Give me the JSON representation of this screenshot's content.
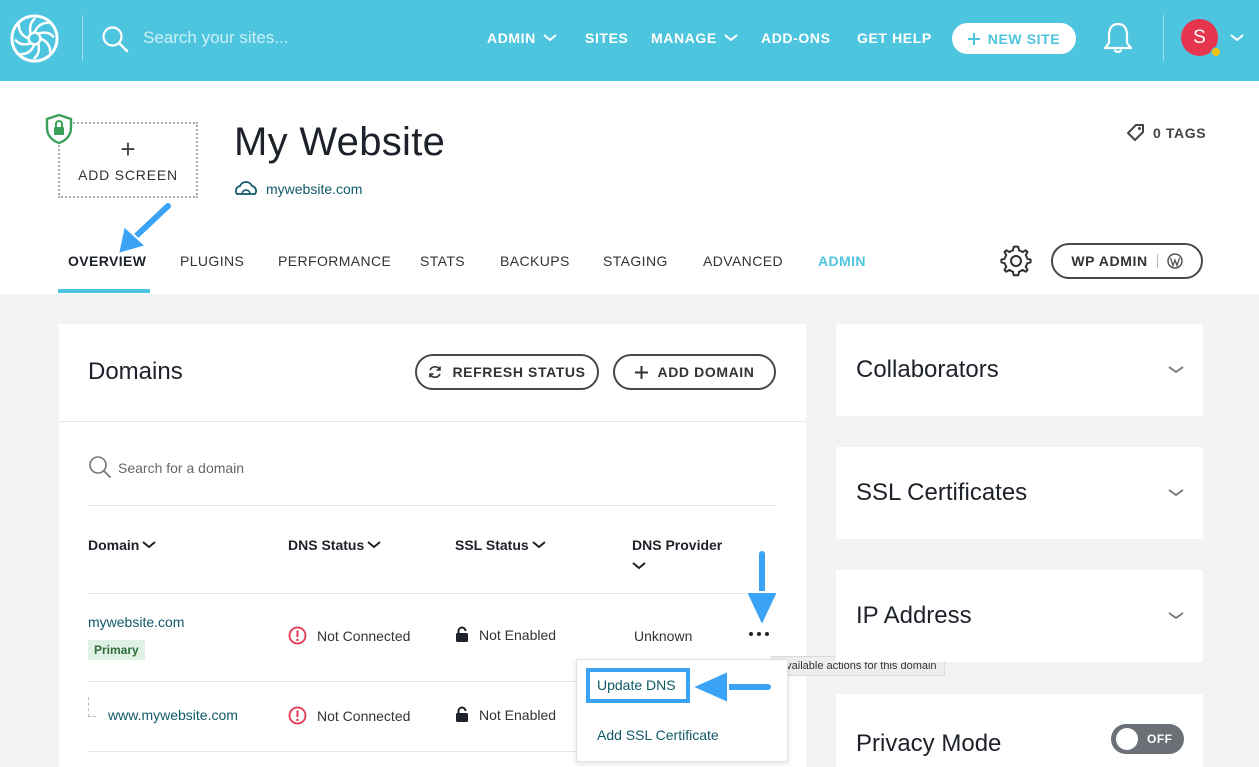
{
  "colors": {
    "topbar": "#4ec5df",
    "accent": "#4ec5df",
    "link": "#0f5969",
    "avatar": "#e5354f",
    "annotation_arrow": "#3aa3f5"
  },
  "topbar": {
    "logo_icon": "flywheel-logo-icon",
    "search_placeholder": "Search your sites...",
    "nav": [
      {
        "label": "ADMIN",
        "has_chevron": true
      },
      {
        "label": "SITES",
        "has_chevron": false
      },
      {
        "label": "MANAGE",
        "has_chevron": true
      },
      {
        "label": "ADD-ONS",
        "has_chevron": false
      },
      {
        "label": "GET HELP",
        "has_chevron": false
      }
    ],
    "new_site_label": "NEW SITE",
    "avatar_initial": "S"
  },
  "site": {
    "add_screen_label": "ADD SCREEN",
    "title": "My Website",
    "url": "mywebsite.com",
    "tags_label": "0 TAGS",
    "tabs": [
      "OVERVIEW",
      "PLUGINS",
      "PERFORMANCE",
      "STATS",
      "BACKUPS",
      "STAGING",
      "ADVANCED",
      "ADMIN"
    ],
    "active_tab": "OVERVIEW",
    "wp_admin_label": "WP ADMIN"
  },
  "domains": {
    "title": "Domains",
    "refresh_label": "REFRESH STATUS",
    "add_label": "ADD DOMAIN",
    "search_placeholder": "Search for a domain",
    "columns": [
      "Domain",
      "DNS Status",
      "SSL Status",
      "DNS Provider"
    ],
    "rows": [
      {
        "domain": "mywebsite.com",
        "badge": "Primary",
        "dns_status": "Not Connected",
        "ssl_status": "Not Enabled",
        "dns_provider": "Unknown"
      },
      {
        "domain": "www.mywebsite.com",
        "dns_status": "Not Connected",
        "ssl_status": "Not Enabled"
      }
    ],
    "actions_tooltip": "Available actions for this domain",
    "actions_menu": [
      "Update DNS",
      "Add SSL Certificate"
    ]
  },
  "sidebar": {
    "cards": [
      "Collaborators",
      "SSL Certificates",
      "IP Address",
      "Privacy Mode"
    ],
    "privacy_toggle_label": "OFF"
  }
}
